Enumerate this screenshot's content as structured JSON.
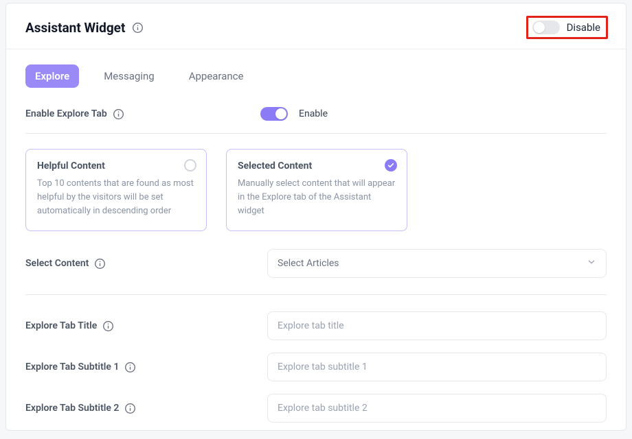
{
  "header": {
    "title": "Assistant Widget",
    "main_toggle_label": "Disable",
    "main_toggle_on": false
  },
  "tabs": [
    {
      "id": "explore",
      "label": "Explore",
      "active": true
    },
    {
      "id": "messaging",
      "label": "Messaging",
      "active": false
    },
    {
      "id": "appearance",
      "label": "Appearance",
      "active": false
    }
  ],
  "explore": {
    "enable_label": "Enable Explore Tab",
    "enable_toggle_label": "Enable",
    "enable_toggle_on": true,
    "content_mode_cards": [
      {
        "id": "helpful",
        "title": "Helpful Content",
        "desc": "Top 10 contents that are found as most helpful by the visitors will be set automatically in descending order",
        "selected": false
      },
      {
        "id": "selected",
        "title": "Selected Content",
        "desc": "Manually select content that will appear in the Explore tab of the Assistant widget",
        "selected": true
      }
    ],
    "select_content_label": "Select Content",
    "select_content_placeholder": "Select Articles",
    "title_field": {
      "label": "Explore Tab Title",
      "placeholder": "Explore tab title",
      "value": ""
    },
    "subtitle1_field": {
      "label": "Explore Tab Subtitle 1",
      "placeholder": "Explore tab subtitle 1",
      "value": ""
    },
    "subtitle2_field": {
      "label": "Explore Tab Subtitle 2",
      "placeholder": "Explore tab subtitle 2",
      "value": ""
    }
  },
  "colors": {
    "accent": "#8b7cf6",
    "highlight_box": "#e1241a"
  }
}
